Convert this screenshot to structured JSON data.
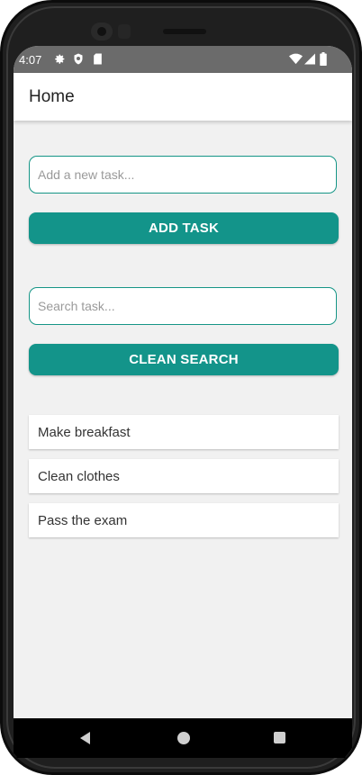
{
  "status_bar": {
    "time": "4:07",
    "icons": [
      "gear-icon",
      "shield-icon",
      "sd-card-icon",
      "wifi-icon",
      "signal-icon",
      "battery-icon"
    ]
  },
  "app_bar": {
    "title": "Home"
  },
  "new_task": {
    "placeholder": "Add a new task...",
    "value": ""
  },
  "add_button": {
    "label": "ADD TASK"
  },
  "search": {
    "placeholder": "Search task...",
    "value": ""
  },
  "clean_button": {
    "label": "CLEAN SEARCH"
  },
  "tasks": [
    {
      "label": "Make breakfast"
    },
    {
      "label": "Clean clothes"
    },
    {
      "label": "Pass the exam"
    }
  ],
  "navigation": {
    "items": [
      "back-icon",
      "home-icon",
      "recents-icon"
    ]
  },
  "colors": {
    "accent": "#13948a",
    "background": "#f1f1f1",
    "status_bar": "#6b6b6b"
  }
}
